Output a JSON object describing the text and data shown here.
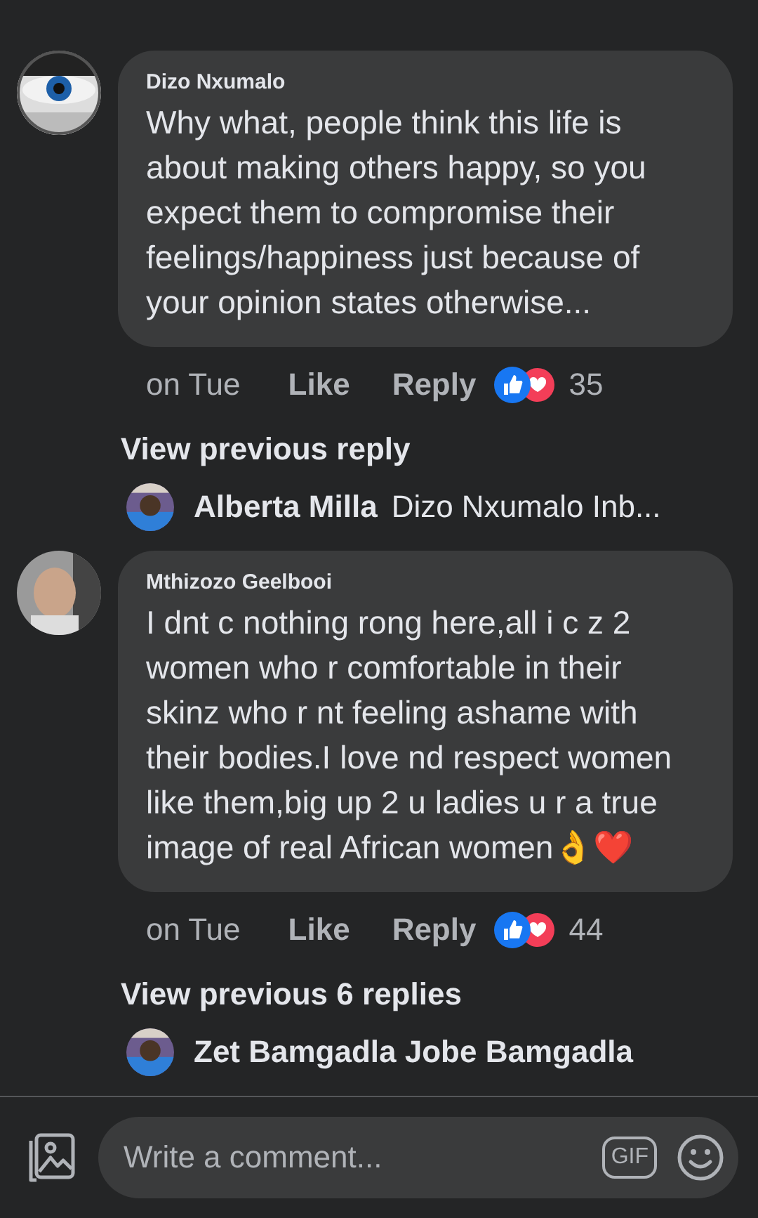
{
  "thread": [
    {
      "kind": "comment",
      "author": "Dizo Nxumalo",
      "text": "Why what, people think this life is about making others happy, so you expect them to compromise their feelings/happiness just because of your opinion states otherwise...",
      "time": "on Tue",
      "like": "Like",
      "reply": "Reply",
      "reaction_count": "35"
    },
    {
      "kind": "more",
      "label": "View previous reply"
    },
    {
      "kind": "preview",
      "author": "Alberta Milla",
      "text": "Dizo Nxumalo Inb..."
    },
    {
      "kind": "comment",
      "author": "Mthizozo Geelbooi",
      "text": "I dnt c nothing rong here,all i c z 2 women who r comfortable in their skinz who r nt feeling ashame with their bodies.I love nd respect women like them,big up 2 u ladies u r a true image of real African women👌❤️",
      "time": "on Tue",
      "like": "Like",
      "reply": "Reply",
      "reaction_count": "44"
    },
    {
      "kind": "more",
      "label": "View previous 6 replies"
    },
    {
      "kind": "preview",
      "author": "Zet Bamgadla Jobe Bamgadla"
    }
  ],
  "composer": {
    "placeholder": "Write a comment...",
    "gif": "GIF"
  }
}
